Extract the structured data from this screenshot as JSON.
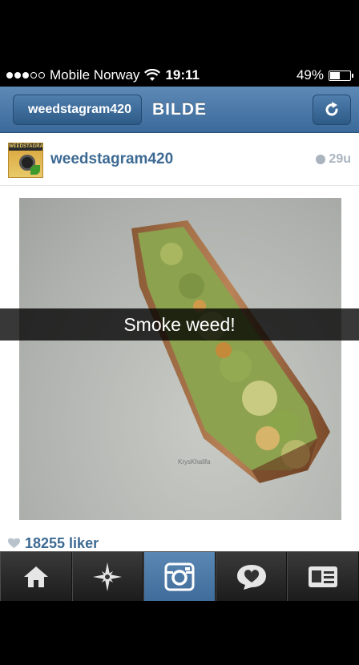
{
  "status_bar": {
    "carrier": "Mobile Norway",
    "time": "19:11",
    "battery_percent": "49%",
    "battery_level": 0.49
  },
  "nav": {
    "back_label": "weedstagram420",
    "title": "BILDE"
  },
  "post": {
    "avatar_text": "WEEDSTAGRAM",
    "username": "weedstagram420",
    "time_ago": "29u",
    "photo_watermark": "KrysKhalifa",
    "caption_overlay": "Smoke weed!",
    "likes": "18255 liker"
  },
  "tabs": [
    {
      "icon": "home-icon"
    },
    {
      "icon": "explore-star-icon"
    },
    {
      "icon": "camera-icon",
      "active": true
    },
    {
      "icon": "activity-heart-bubble-icon"
    },
    {
      "icon": "profile-card-icon"
    }
  ],
  "colors": {
    "nav_blue": "#4a79a8",
    "link_blue": "#3d6a93",
    "tab_active": "#4f7fae"
  }
}
